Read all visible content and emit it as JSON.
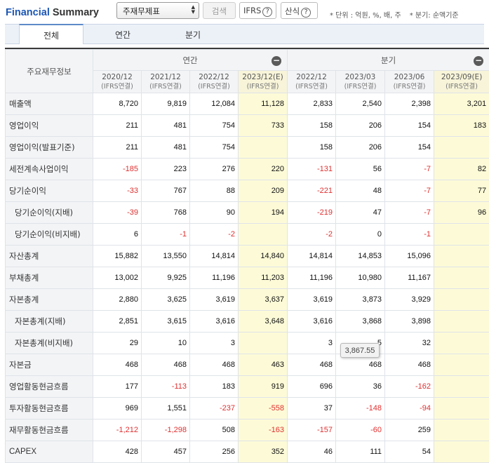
{
  "header": {
    "title_part1": "Financial",
    "title_part2": "Summary",
    "select_value": "주재무제표",
    "search_label": "검색",
    "ifrs_label": "IFRS",
    "formula_label": "산식",
    "help_glyph": "?",
    "unit_note": "* 단위 : 억원, %, 배, 주",
    "quarter_note": "* 분기: 순액기준"
  },
  "tabs": [
    "전체",
    "연간",
    "분기"
  ],
  "table": {
    "row_header": "주요재무정보",
    "group_annual": "연간",
    "group_quarterly": "분기",
    "collapse_glyph": "−",
    "periods": [
      {
        "label": "2020/12",
        "sub": "(IFRS연결)",
        "est": false
      },
      {
        "label": "2021/12",
        "sub": "(IFRS연결)",
        "est": false
      },
      {
        "label": "2022/12",
        "sub": "(IFRS연결)",
        "est": false
      },
      {
        "label": "2023/12(E)",
        "sub": "(IFRS연결)",
        "est": true
      },
      {
        "label": "2022/12",
        "sub": "(IFRS연결)",
        "est": false
      },
      {
        "label": "2023/03",
        "sub": "(IFRS연결)",
        "est": false
      },
      {
        "label": "2023/06",
        "sub": "(IFRS연결)",
        "est": false
      },
      {
        "label": "2023/09(E)",
        "sub": "(IFRS연결)",
        "est": true
      }
    ],
    "rows": [
      {
        "label": "매출액",
        "indent": false,
        "values": [
          "8,720",
          "9,819",
          "12,084",
          "11,128",
          "2,833",
          "2,540",
          "2,398",
          "3,201"
        ]
      },
      {
        "label": "영업이익",
        "indent": false,
        "values": [
          "211",
          "481",
          "754",
          "733",
          "158",
          "206",
          "154",
          "183"
        ]
      },
      {
        "label": "영업이익(발표기준)",
        "indent": false,
        "values": [
          "211",
          "481",
          "754",
          "",
          "158",
          "206",
          "154",
          ""
        ]
      },
      {
        "label": "세전계속사업이익",
        "indent": false,
        "values": [
          "-185",
          "223",
          "276",
          "220",
          "-131",
          "56",
          "-7",
          "82"
        ]
      },
      {
        "label": "당기순이익",
        "indent": false,
        "values": [
          "-33",
          "767",
          "88",
          "209",
          "-221",
          "48",
          "-7",
          "77"
        ]
      },
      {
        "label": "당기순이익(지배)",
        "indent": true,
        "values": [
          "-39",
          "768",
          "90",
          "194",
          "-219",
          "47",
          "-7",
          "96"
        ]
      },
      {
        "label": "당기순이익(비지배)",
        "indent": true,
        "values": [
          "6",
          "-1",
          "-2",
          "",
          "-2",
          "0",
          "-1",
          ""
        ]
      },
      {
        "label": "자산총계",
        "indent": false,
        "values": [
          "15,882",
          "13,550",
          "14,814",
          "14,840",
          "14,814",
          "14,853",
          "15,096",
          ""
        ]
      },
      {
        "label": "부채총계",
        "indent": false,
        "values": [
          "13,002",
          "9,925",
          "11,196",
          "11,203",
          "11,196",
          "10,980",
          "11,167",
          ""
        ]
      },
      {
        "label": "자본총계",
        "indent": false,
        "values": [
          "2,880",
          "3,625",
          "3,619",
          "3,637",
          "3,619",
          "3,873",
          "3,929",
          ""
        ]
      },
      {
        "label": "자본총계(지배)",
        "indent": true,
        "values": [
          "2,851",
          "3,615",
          "3,616",
          "3,648",
          "3,616",
          "3,868",
          "3,898",
          ""
        ]
      },
      {
        "label": "자본총계(비지배)",
        "indent": true,
        "values": [
          "29",
          "10",
          "3",
          "",
          "3",
          "5",
          "32",
          ""
        ]
      },
      {
        "label": "자본금",
        "indent": false,
        "values": [
          "468",
          "468",
          "468",
          "463",
          "468",
          "468",
          "468",
          ""
        ]
      },
      {
        "label": "영업활동현금흐름",
        "indent": false,
        "values": [
          "177",
          "-113",
          "183",
          "919",
          "696",
          "36",
          "-162",
          ""
        ]
      },
      {
        "label": "투자활동현금흐름",
        "indent": false,
        "values": [
          "969",
          "1,551",
          "-237",
          "-558",
          "37",
          "-148",
          "-94",
          ""
        ]
      },
      {
        "label": "재무활동현금흐름",
        "indent": false,
        "values": [
          "-1,212",
          "-1,298",
          "508",
          "-163",
          "-157",
          "-60",
          "259",
          ""
        ]
      },
      {
        "label": "CAPEX",
        "indent": false,
        "values": [
          "428",
          "457",
          "256",
          "352",
          "46",
          "111",
          "54",
          ""
        ]
      }
    ]
  },
  "tooltip": {
    "text": "3,867.55"
  }
}
